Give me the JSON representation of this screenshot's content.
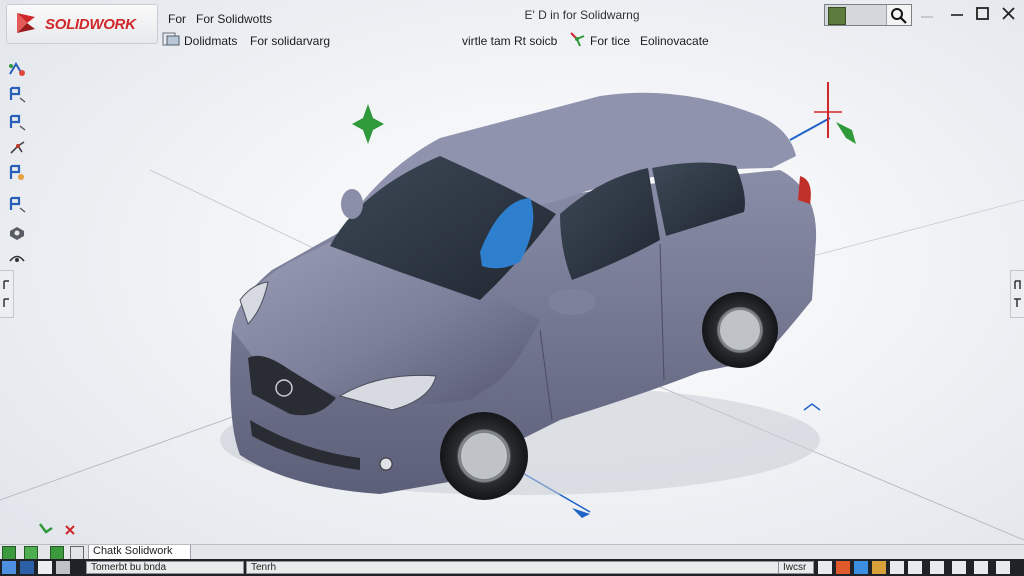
{
  "app": {
    "logo_text": "SOLIDWORK",
    "title": "E' D in for Solidwarng"
  },
  "menus": {
    "row1": [
      "For",
      "For Solidwotts"
    ],
    "row2": [
      "Dolidmats",
      "For solidarvarg"
    ],
    "toolbar": [
      "virtle tam Rt soicb",
      "For tice",
      "Eolinovacate"
    ]
  },
  "bottom": {
    "tab_label": "Chatk Solidwork",
    "taskbar": {
      "item1": "Tomerbt bu bnda",
      "item2": "Tenrh",
      "item3": "Iwcsr"
    }
  },
  "icons": {
    "logo": "solidworks-logo-icon",
    "search": "search-icon",
    "minimize": "minimize-icon",
    "maximize": "maximize-icon",
    "close": "close-icon"
  },
  "colors": {
    "car_body": "#7b7f99",
    "accent_red": "#d0272a",
    "triad_green": "#2f9a3a",
    "axis_blue": "#1f63c9"
  }
}
